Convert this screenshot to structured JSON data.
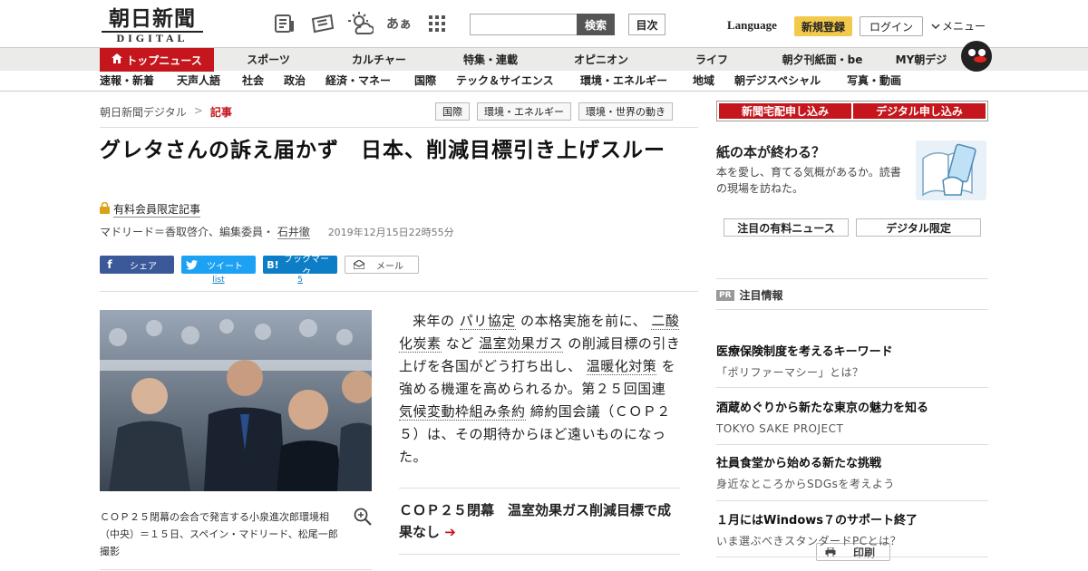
{
  "header": {
    "logo_main": "朝日新聞",
    "logo_sub": "DIGITAL",
    "search_button": "検索",
    "search_value": "",
    "mokuji": "目次",
    "language": "Language",
    "register": "新規登録",
    "login": "ログイン",
    "menu": "メニュー",
    "icons": [
      "newspaper-icon",
      "ticket-icon",
      "weather-icon",
      "font-size-icon",
      "grid-icon"
    ],
    "font_icon_text": "あぁ"
  },
  "nav": {
    "top": "トップニュース",
    "items": [
      "スポーツ",
      "カルチャー",
      "特集・連載",
      "オピニオン",
      "ライフ",
      "朝夕刊紙面・be",
      "MY朝デジ"
    ]
  },
  "subnav": {
    "items": [
      "速報・新着",
      "天声人語",
      "社会",
      "政治",
      "経済・マネー",
      "国際",
      "テック＆サイエンス",
      "環境・エネルギー",
      "地域",
      "朝デジスペシャル",
      "写真・動画"
    ]
  },
  "breadcrumb": {
    "home": "朝日新聞デジタル",
    "sep": ">",
    "current": "記事"
  },
  "tags": [
    "国際",
    "環境・エネルギー",
    "環境・世界の動き"
  ],
  "article": {
    "title": "グレタさんの訴え届かず　日本、削減目標引き上げスルー",
    "paid_label": "有料会員限定記事",
    "byline_prefix": "マドリード＝香取啓介、編集委員・",
    "byline_name": "石井徹",
    "date": "2019年12月15日22時55分",
    "caption": "ＣＯＰ２５閉幕の会合で発言する小泉進次郎環境相（中央）＝１５日、スペイン・マドリード、松尾一郎撮影",
    "body": [
      {
        "t": "来年の ",
        "k": false
      },
      {
        "t": "パリ協定",
        "k": true
      },
      {
        "t": " の本格実施を前に、 ",
        "k": false
      },
      {
        "t": "二酸化炭素",
        "k": true
      },
      {
        "t": " など ",
        "k": false
      },
      {
        "t": "温室効果ガス",
        "k": true
      },
      {
        "t": " の削減目標の引き上げを各国がどう打ち出し、 ",
        "k": false
      },
      {
        "t": "温暖化対策",
        "k": true
      },
      {
        "t": " を強める機運を高められるか。第２５回国連 ",
        "k": false
      },
      {
        "t": "気候変動枠組み条約",
        "k": true
      },
      {
        "t": " 締約国会議（ＣＯＰ２５）は、その期待からほど遠いものになった。",
        "k": false
      }
    ],
    "related": "ＣＯＰ２５閉幕　温室効果ガス削減目標で成果なし",
    "related_arrow": "➔"
  },
  "share": {
    "facebook": "シェア",
    "twitter": "ツイート",
    "hatena": "ブックマーク",
    "mail": "メール",
    "print": "印刷",
    "twitter_count": "list",
    "hatena_count": "5"
  },
  "right": {
    "btn1": "新聞宅配申し込み",
    "btn2": "デジタル申し込み",
    "promo_title": "紙の本が終わる？",
    "promo_desc": "本を愛し、育てる気概があるか。読書の現場を訪ねた。",
    "tab1": "注目の有料ニュース",
    "tab2": "デジタル限定",
    "pr_badge": "PR",
    "pr_label": "注目情報",
    "items": [
      {
        "title": "医療保険制度を考えるキーワード",
        "sub": "「ポリファーマシー」とは？"
      },
      {
        "title": "酒蔵めぐりから新たな東京の魅力を知る",
        "sub": "TOKYO SAKE PROJECT"
      },
      {
        "title": "社員食堂から始める新たな挑戦",
        "sub": "身近なところからSDGsを考えよう"
      },
      {
        "title": "１月にはWindows７のサポート終了",
        "sub": "いま選ぶべきスタンダードPCとは？"
      }
    ]
  }
}
